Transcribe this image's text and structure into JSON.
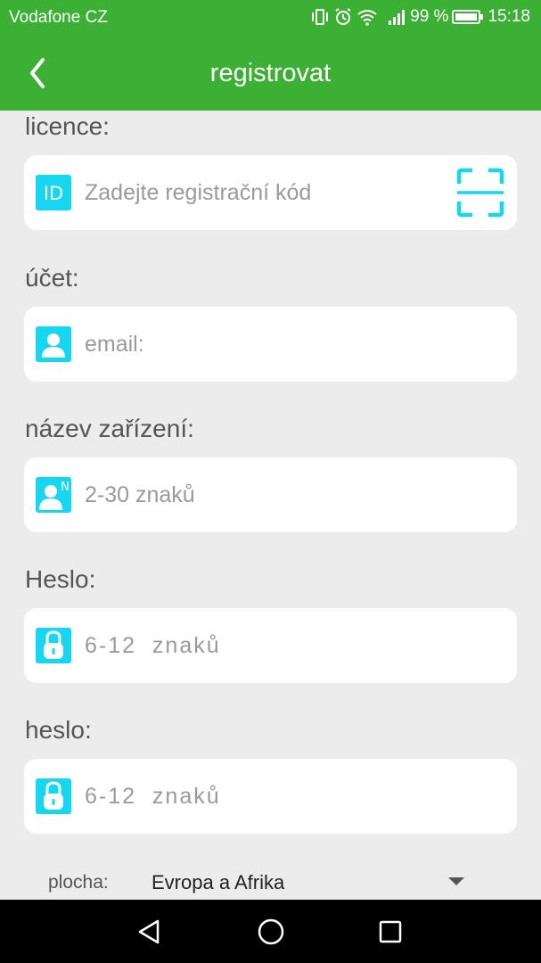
{
  "status_bar": {
    "carrier": "Vodafone CZ",
    "battery": "99 %",
    "time": "15:18",
    "icons": [
      "vibrate-icon",
      "alarm-icon",
      "wifi-icon",
      "signal-icon",
      "battery-icon"
    ]
  },
  "app_bar": {
    "title": "registrovat",
    "back_icon": "back-chevron-icon"
  },
  "form": {
    "license": {
      "label": "licence:",
      "placeholder": "Zadejte registrační kód",
      "icon": "id-icon",
      "action_icon": "scan-qr-icon"
    },
    "account": {
      "label": "účet:",
      "placeholder": "email:",
      "icon": "user-icon"
    },
    "device_name": {
      "label": "název zařízení:",
      "placeholder": "2-30 znaků",
      "icon": "user-name-icon",
      "icon_badge": "N"
    },
    "password": {
      "label": "Heslo:",
      "placeholder": "6-12  znaků",
      "icon": "lock-icon"
    },
    "password_confirm": {
      "label": "heslo:",
      "placeholder": "6-12  znaků",
      "icon": "lock-icon"
    },
    "region": {
      "label": "plocha:",
      "value": "Evropa a Afrika",
      "icon": "dropdown-caret-icon"
    }
  },
  "colors": {
    "primary_green": "#3cb034",
    "icon_cyan": "#16d6f0",
    "background": "#ececec"
  },
  "nav_bar": {
    "icons": [
      "nav-back-icon",
      "nav-home-icon",
      "nav-recents-icon"
    ]
  }
}
